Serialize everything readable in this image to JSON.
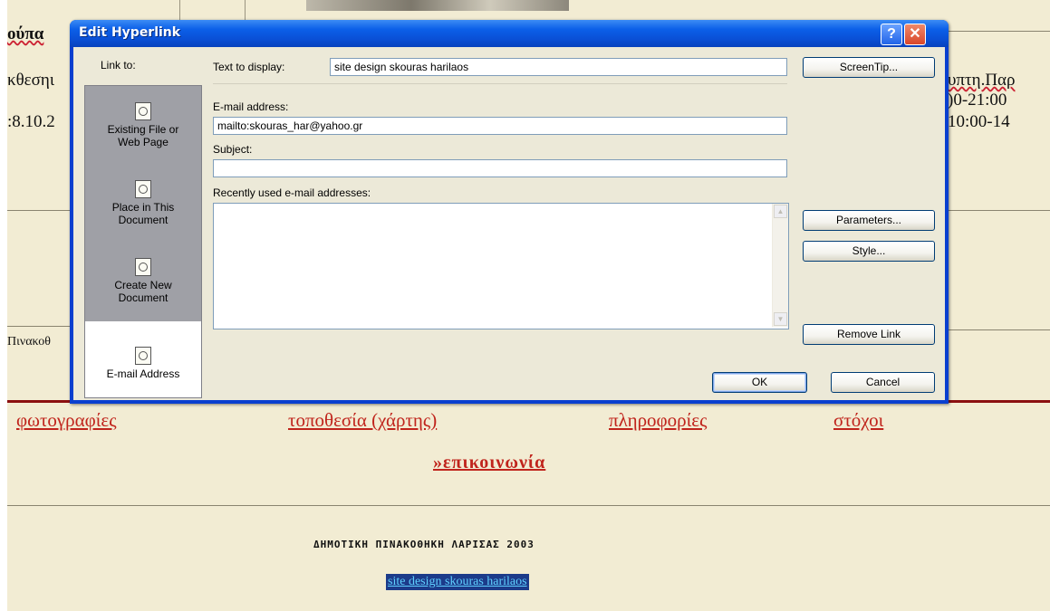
{
  "background": {
    "top_left_fragment": "ούπα",
    "left_fragment_2": "κθεσηι",
    "left_fragment_3": ":8.10.2",
    "right_fragment_1": "υπτη.Παρ",
    "right_fragment_2": ")0-21:00",
    "right_fragment_3": "10:00-14",
    "left_fragment_4": "Πινακοθ",
    "nav_links": [
      "φωτογραφίες",
      "τοποθεσία (χάρτης)",
      "πληροφορίες",
      "στόχοι"
    ],
    "contact_link": "»επικοινωνία",
    "footer_title": "ΔΗΜΟΤΙΚΗ ΠΙΝΑΚΟΘΗΚΗ ΛΑΡΙΣΑΣ 2003",
    "footer_credit": "site design skouras harilaos",
    "link_color": "#c0241c"
  },
  "dialog": {
    "title": "Edit Hyperlink",
    "help_glyph": "?",
    "close_glyph": "✕",
    "link_to_label": "Link to:",
    "link_options": [
      {
        "label_line1": "Existing File or",
        "label_line2": "Web Page",
        "icon": "globe-file-icon"
      },
      {
        "label_line1": "Place in This",
        "label_line2": "Document",
        "icon": "document-place-icon"
      },
      {
        "label_line1": "Create New",
        "label_line2": "Document",
        "icon": "new-document-icon"
      },
      {
        "label_line1": "E-mail Address",
        "label_line2": "",
        "icon": "email-icon",
        "selected": true
      }
    ],
    "text_to_display_label": "Text to display:",
    "text_to_display_value": "site design skouras harilaos",
    "screentip_button": "ScreenTip...",
    "email_label": "E-mail address:",
    "email_value": "mailto:skouras_har@yahoo.gr",
    "subject_label": "Subject:",
    "subject_value": "",
    "recent_label": "Recently used e-mail addresses:",
    "parameters_button": "Parameters...",
    "style_button": "Style...",
    "remove_link_button": "Remove Link",
    "ok_button": "OK",
    "cancel_button": "Cancel"
  }
}
